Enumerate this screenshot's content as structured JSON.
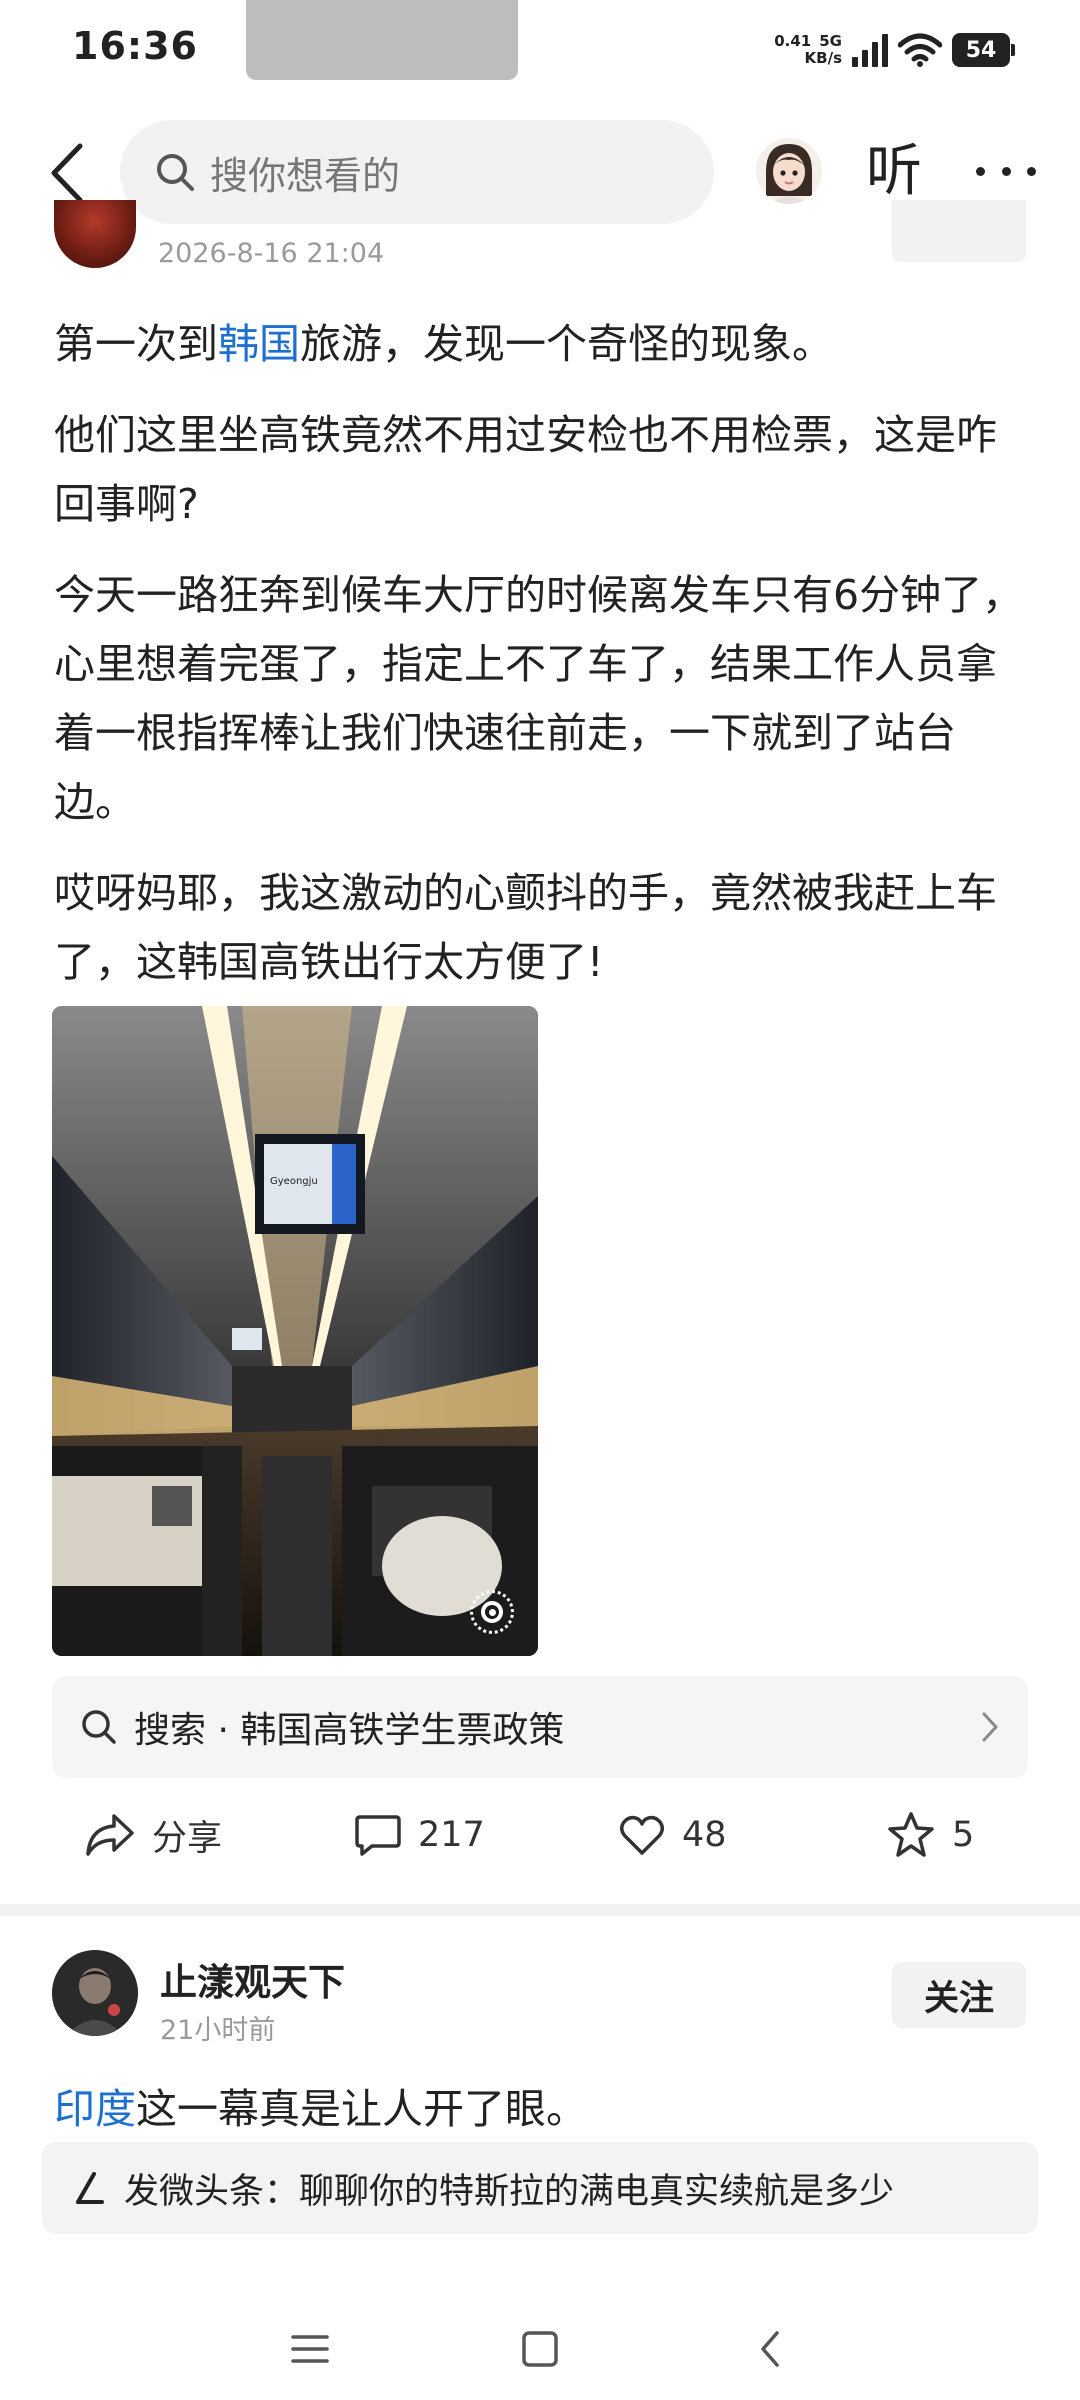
{
  "status_bar": {
    "time": "16:36",
    "net_speed_value": "0.41",
    "net_speed_unit": "KB/s",
    "network_type": "5G",
    "battery": "54"
  },
  "top_nav": {
    "search_placeholder": "搜你想看的",
    "listen_label": "听"
  },
  "prev_post": {
    "time": "2026-8-16 21:04"
  },
  "post": {
    "p1_prefix": "第一次到",
    "p1_link": "韩国",
    "p1_suffix": "旅游，发现一个奇怪的现象。",
    "p2": "他们这里坐高铁竟然不用过安检也不用检票，这是咋回事啊?",
    "p3": "今天一路狂奔到候车大厅的时候离发车只有6分钟了，心里想着完蛋了，指定上不了车了，结果工作人员拿着一根指挥棒让我们快速往前走，一下就到了站台边。",
    "p4": "哎呀妈耶，我这激动的心颤抖的手，竟然被我赶上车了，这韩国高铁出行太方便了!",
    "image_screen_text": "Gyeongju"
  },
  "related_search": {
    "text": "搜索 · 韩国高铁学生票政策"
  },
  "actions": {
    "share_label": "分享",
    "comments": "217",
    "likes": "48",
    "favorites": "5"
  },
  "next_post": {
    "author": "止漾观天下",
    "time": "21小时前",
    "follow_label": "关注",
    "text_link": "印度",
    "text_suffix": "这一幕真是让人开了眼。"
  },
  "compose_bar": {
    "text": "发微头条：聊聊你的特斯拉的满电真实续航是多少"
  },
  "colors": {
    "link": "#1d6fd0",
    "text": "#222222",
    "muted": "#9a9a9a",
    "panel": "#f2f2f2"
  }
}
